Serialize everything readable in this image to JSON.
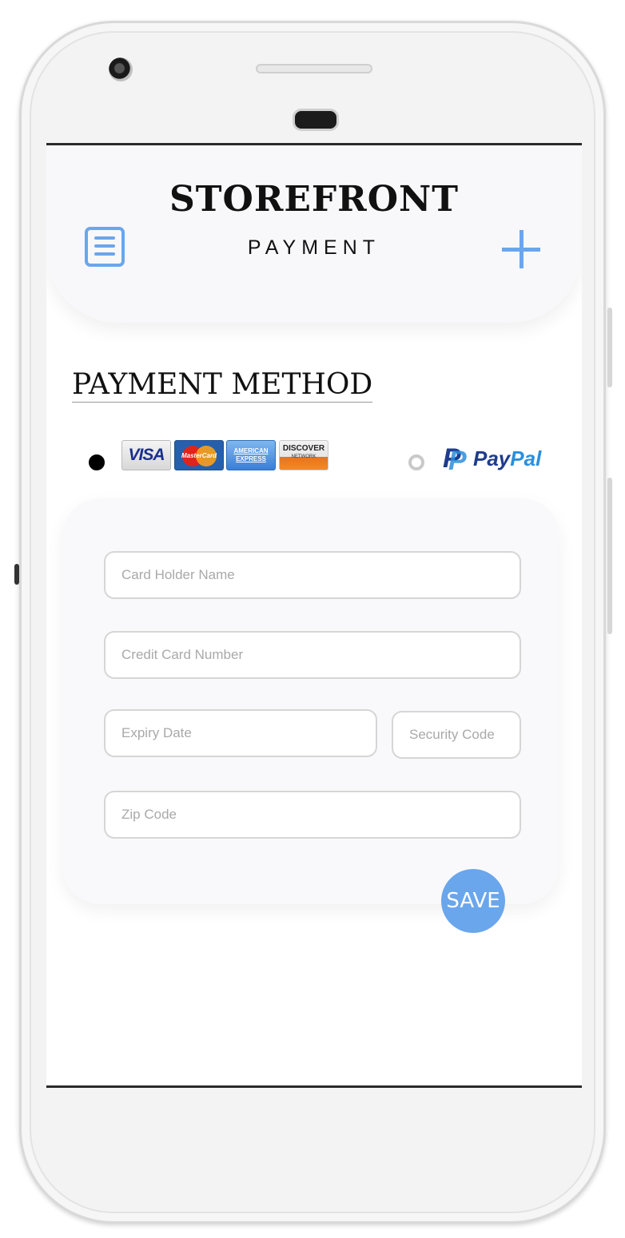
{
  "app": {
    "brand": "STOREFRONT",
    "subtitle": "PAYMENT",
    "menu_icon": "menu-icon",
    "add_icon": "plus-icon"
  },
  "payment_method": {
    "title": "PAYMENT METHOD",
    "options": [
      {
        "id": "cards",
        "selected": true,
        "logos": [
          "VISA",
          "MasterCard",
          "AMERICAN EXPRESS",
          "DISCOVER NETWORK"
        ]
      },
      {
        "id": "paypal",
        "selected": false,
        "label": "PayPal"
      }
    ],
    "visa_label": "VISA",
    "mastercard_label": "MasterCard",
    "amex_line1": "AMERICAN",
    "amex_line2": "EXPRESS",
    "discover_label": "DISCOVER",
    "discover_sub": "NETWORK",
    "paypal_mark": "P",
    "paypal_pay": "Pay",
    "paypal_pal": "Pal"
  },
  "form": {
    "card_holder_placeholder": "Card Holder Name",
    "card_number_placeholder": "Credit Card Number",
    "expiry_placeholder": "Expiry Date",
    "security_placeholder": "Security Code",
    "zip_placeholder": "Zip Code",
    "save_label": "SAVE"
  },
  "colors": {
    "accent": "#6aa6ec",
    "header_bg": "#f8f8fa",
    "paypal_dark": "#1f3c8c",
    "paypal_light": "#2b8fdc"
  }
}
